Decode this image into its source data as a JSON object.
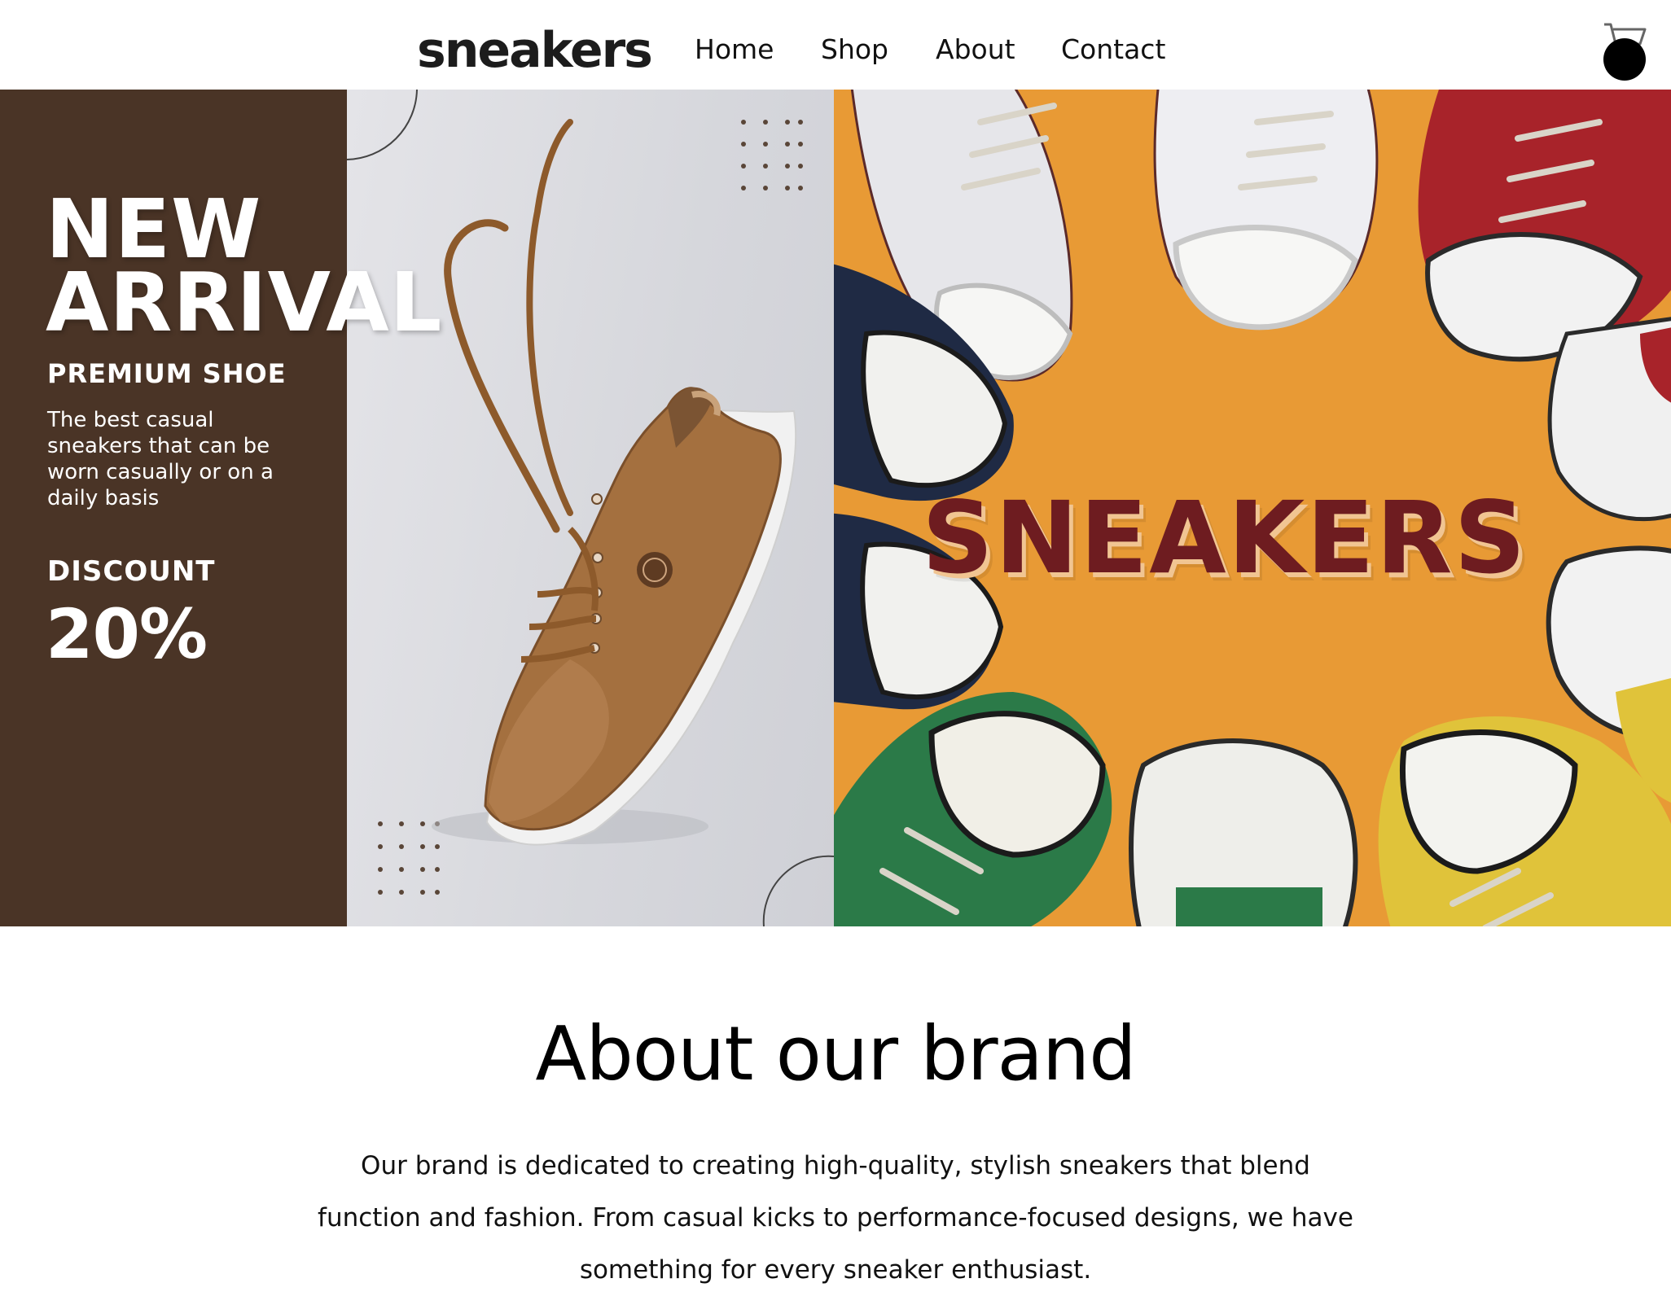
{
  "nav": {
    "logo": "sneakers",
    "links": [
      {
        "label": "Home"
      },
      {
        "label": "Shop"
      },
      {
        "label": "About"
      },
      {
        "label": "Contact"
      }
    ],
    "cart_icon": "shopping-cart-icon"
  },
  "hero": {
    "promo": {
      "headline_line1": "NEW",
      "headline_line2": "ARRIVAL",
      "subheading": "PREMIUM SHOE",
      "description": "The best casual sneakers that can be worn casually or on a daily basis",
      "discount_label": "DISCOUNT",
      "discount_value": "20%",
      "colors": {
        "panel": "#4a3426",
        "background": "#dcdde2"
      }
    },
    "collage": {
      "title": "SNEAKERS",
      "colors": {
        "background": "#e89a35",
        "title": "#6e1c20"
      }
    }
  },
  "about": {
    "title": "About our brand",
    "text": "Our brand is dedicated to creating high-quality, stylish sneakers that blend function and fashion. From casual kicks to performance-focused designs, we have something for every sneaker enthusiast."
  }
}
